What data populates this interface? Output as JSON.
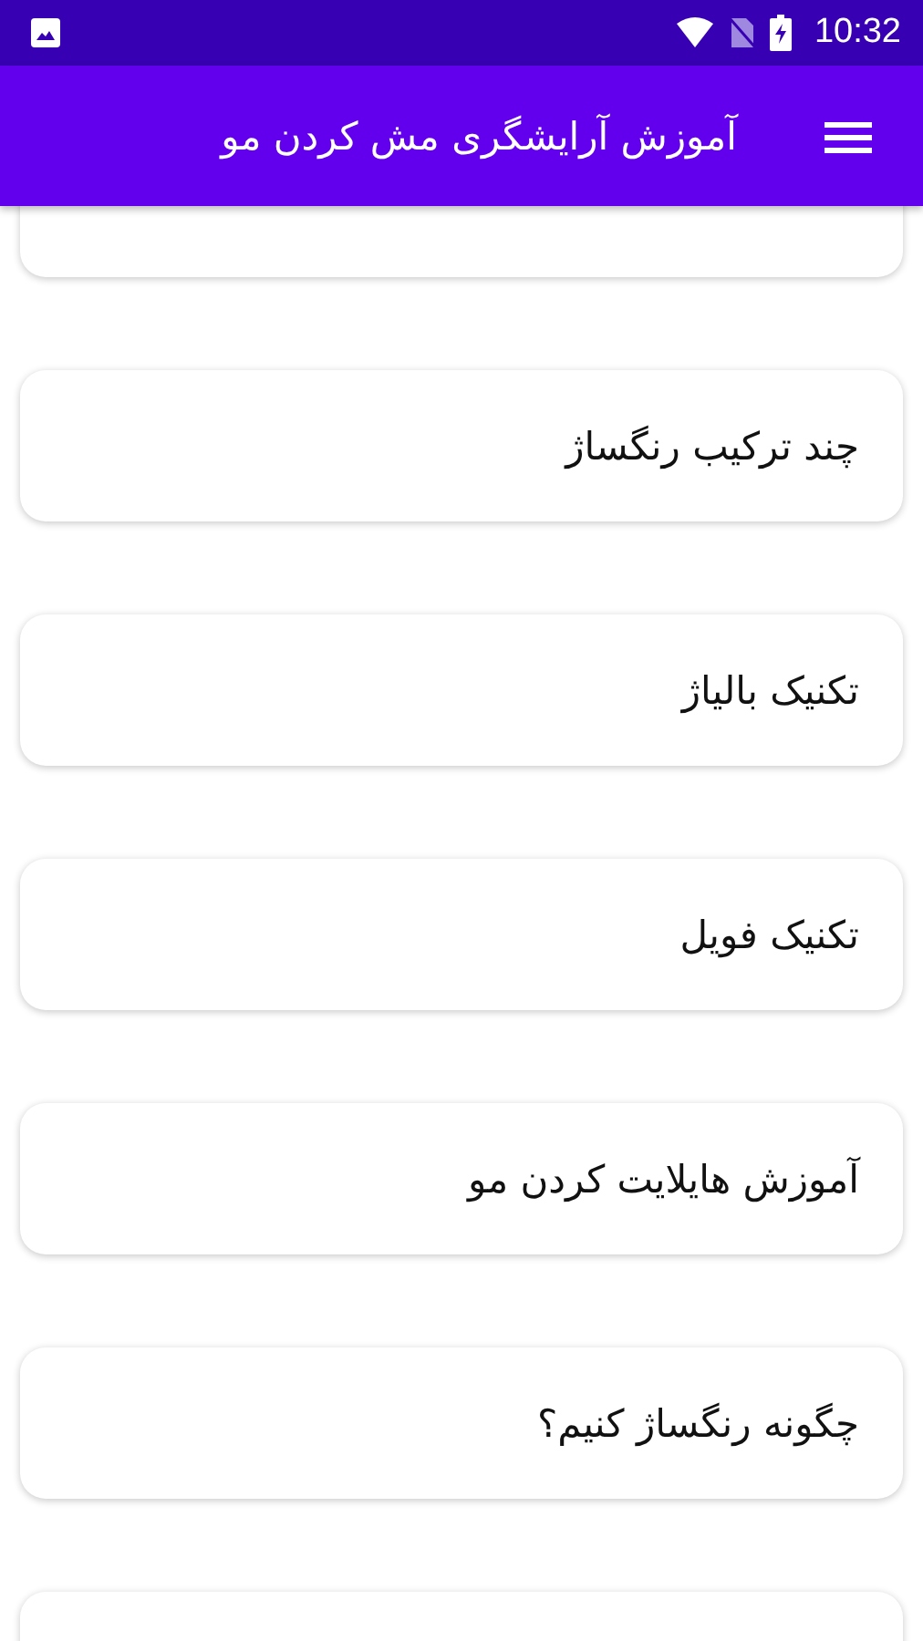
{
  "status_bar": {
    "time": "10:32"
  },
  "app_bar": {
    "title": "آموزش آرایشگری مش کردن مو"
  },
  "items": [
    {
      "title": "چند ترکیب رنگساژ"
    },
    {
      "title": "تکنیک بالیاژ"
    },
    {
      "title": "تکنیک فویل"
    },
    {
      "title": "آموزش هایلایت کردن مو"
    },
    {
      "title": "چگونه رنگساژ کنیم؟"
    }
  ]
}
